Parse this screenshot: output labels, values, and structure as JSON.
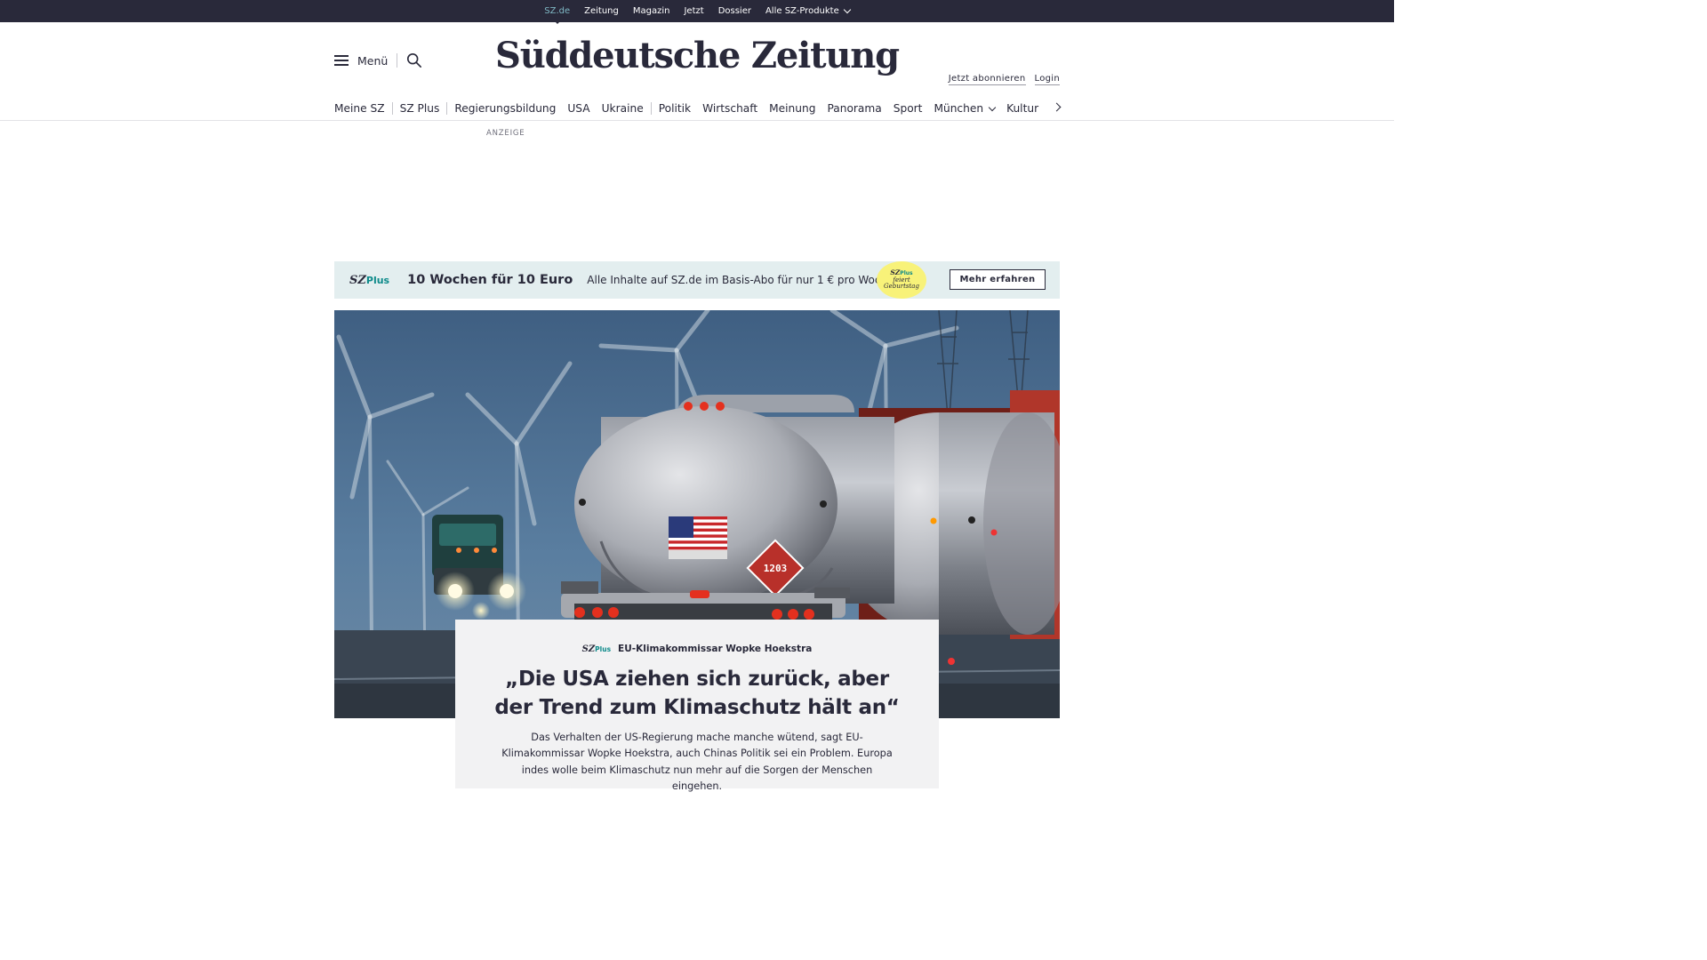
{
  "topbar": {
    "items": [
      "SZ.de",
      "Zeitung",
      "Magazin",
      "Jetzt",
      "Dossier",
      "Alle SZ-Produkte"
    ]
  },
  "header": {
    "menu_label": "Menü",
    "logo": "Süddeutsche Zeitung",
    "subscribe": "Jetzt abonnieren",
    "login": "Login"
  },
  "nav": {
    "items": [
      "Meine SZ",
      "SZ Plus",
      "Regierungsbildung",
      "USA",
      "Ukraine",
      "Politik",
      "Wirtschaft",
      "Meinung",
      "Panorama",
      "Sport",
      "München",
      "Kultur"
    ]
  },
  "ad": {
    "label": "ANZEIGE"
  },
  "promo": {
    "logo_sz": "SZ",
    "logo_plus": "Plus",
    "title": "10 Wochen für 10 Euro",
    "text": "Alle Inhalte auf SZ.de im Basis-Abo für nur 1 € pro Woche.",
    "badge_sz": "SZ",
    "badge_plus": "Plus",
    "badge_line1": "feiert",
    "badge_line2": "Geburtstag",
    "button": "Mehr erfahren"
  },
  "teaser": {
    "kicker_sz": "SZ",
    "kicker_plus": "Plus",
    "kicker": "EU-Klimakommissar Wopke Hoekstra",
    "headline": "„Die USA ziehen sich zurück, aber der Trend zum Klimaschutz hält an“",
    "lead": "Das Verhalten der US-Regierung mache manche wütend, sagt EU-Klimakommissar Wopke Hoekstra, auch Chinas Politik sei ein Problem. Europa indes wolle beim Klimaschutz nun mehr auf die Sorgen der Menschen eingehen."
  },
  "hero": {
    "hazard_number": "1203"
  },
  "colors": {
    "dark": "#29293a",
    "accent_teal": "#0d8a8a",
    "topbar_active": "#7fb8c4",
    "promo_bg": "#e3eeef",
    "badge_yellow": "#f8f279",
    "teaser_bg": "#f2f2f3"
  }
}
